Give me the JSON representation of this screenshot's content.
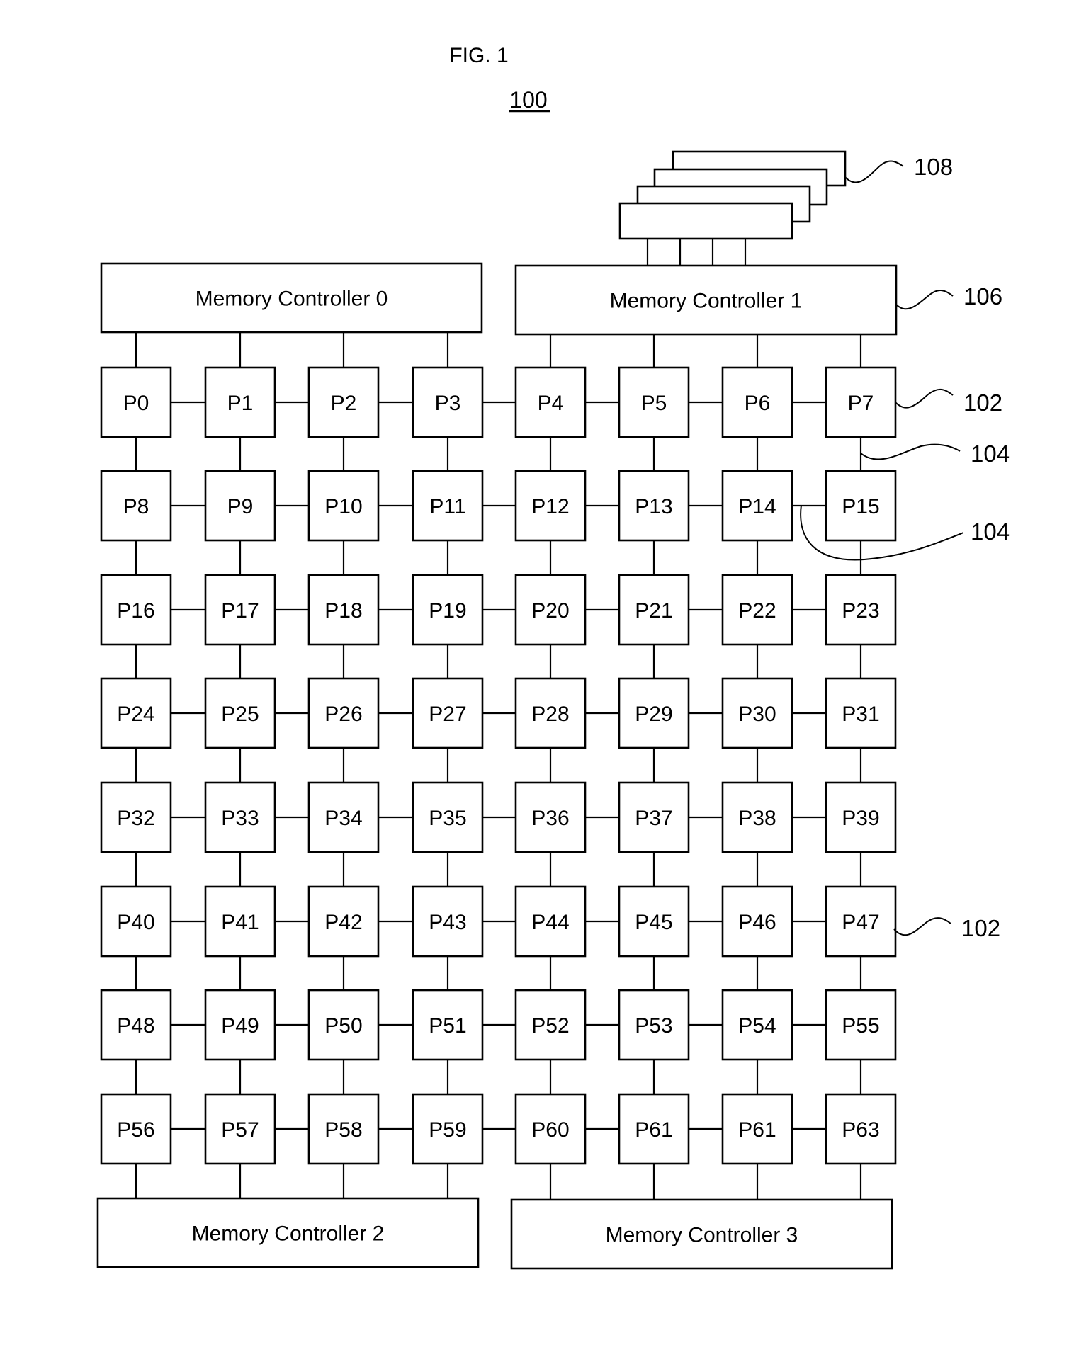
{
  "figure": {
    "title": "FIG. 1",
    "reference_number": "100"
  },
  "memory_controllers": [
    {
      "label": "Memory Controller 0"
    },
    {
      "label": "Memory Controller 1"
    },
    {
      "label": "Memory Controller 2"
    },
    {
      "label": "Memory Controller 3"
    }
  ],
  "processors": [
    "P0",
    "P1",
    "P2",
    "P3",
    "P4",
    "P5",
    "P6",
    "P7",
    "P8",
    "P9",
    "P10",
    "P11",
    "P12",
    "P13",
    "P14",
    "P15",
    "P16",
    "P17",
    "P18",
    "P19",
    "P20",
    "P21",
    "P22",
    "P23",
    "P24",
    "P25",
    "P26",
    "P27",
    "P28",
    "P29",
    "P30",
    "P31",
    "P32",
    "P33",
    "P34",
    "P35",
    "P36",
    "P37",
    "P38",
    "P39",
    "P40",
    "P41",
    "P42",
    "P43",
    "P44",
    "P45",
    "P46",
    "P47",
    "P48",
    "P49",
    "P50",
    "P51",
    "P52",
    "P53",
    "P54",
    "P55",
    "P56",
    "P57",
    "P58",
    "P59",
    "P60",
    "P61",
    "P61",
    "P63"
  ],
  "grid": {
    "rows": 8,
    "cols": 8
  },
  "memory_modules": {
    "count": 4
  },
  "callouts": [
    {
      "id": "memory-modules",
      "label": "108"
    },
    {
      "id": "memory-controller",
      "label": "106"
    },
    {
      "id": "processor-p7",
      "label": "102"
    },
    {
      "id": "link-vertical",
      "label": "104"
    },
    {
      "id": "link-horizontal",
      "label": "104"
    },
    {
      "id": "processor-p47",
      "label": "102"
    }
  ]
}
